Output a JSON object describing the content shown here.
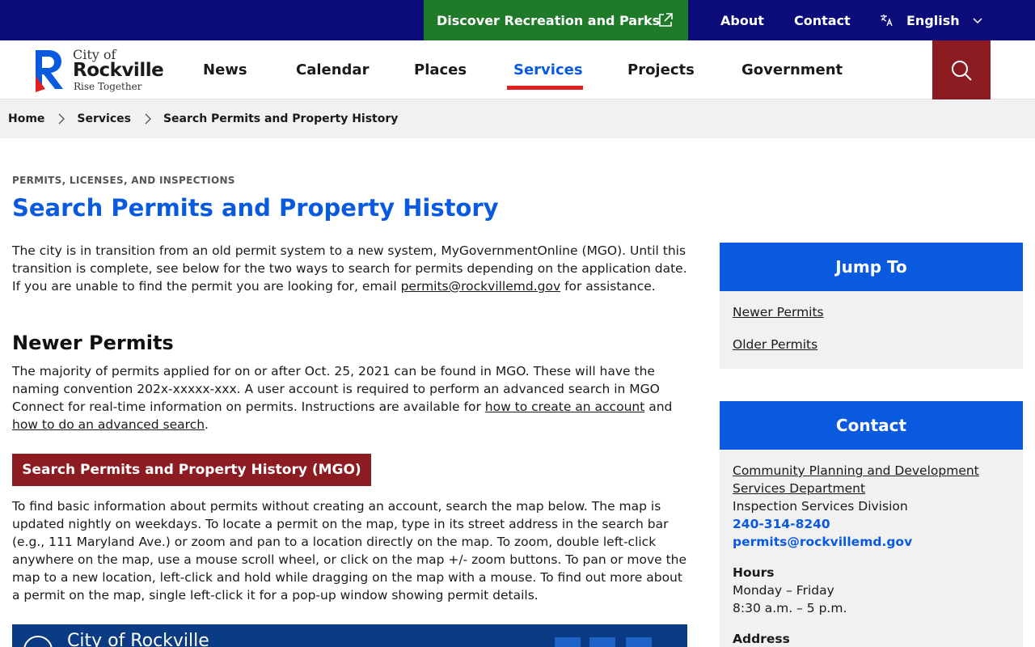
{
  "topbar": {
    "recreation_label": "Discover Recreation and Parks",
    "about": "About",
    "contact": "Contact",
    "language": "English"
  },
  "logo": {
    "city": "City of",
    "name": "Rockville",
    "tagline": "Rise Together"
  },
  "nav": {
    "items": [
      "News",
      "Calendar",
      "Places",
      "Services",
      "Projects",
      "Government"
    ],
    "active": "Services"
  },
  "breadcrumb": [
    "Home",
    "Services",
    "Search Permits and Property History"
  ],
  "main": {
    "eyebrow": "PERMITS, LICENSES, AND INSPECTIONS",
    "title": "Search Permits and Property History",
    "intro_text": "The city is in transition from an old permit system to a new system, MyGovernmentOnline (MGO). Until this transition is complete, see below for the two ways to search for permits depending on the application date. If you are unable to find the permit you are looking for, email ",
    "intro_email": "permits@rockvillemd.gov",
    "intro_tail": " for assistance.",
    "newer_heading": "Newer Permits",
    "newer_text": "The majority of permits applied for on or after Oct. 25, 2021 can be found in MGO. These will have the naming convention 202x-xxxxx-xxx. A user account is required to perform an advanced search in MGO Connect for real-time information on permits. Instructions are available for ",
    "newer_link1": "how to create an account",
    "newer_and": " and ",
    "newer_link2": "how to do an advanced search",
    "newer_period": ".",
    "cta_label": "Search Permits and Property History (MGO)",
    "map_text": "To find basic information about permits without creating an account, search the map below. The map is updated nightly on weekdays. To locate a permit on the map, type in its street address in the search bar (e.g., 111 Maryland Ave.) or zoom and pan to a location directly on the map. To zoom, double left-click anywhere on the map, use a mouse scroll wheel, or click on the map +/- zoom buttons. To pan or move the map to a new location, left-click and hold while dragging on the map with a mouse. To find out more about a permit on the map, single left-click it for a pop-up window showing permit details.",
    "map_title": "City of Rockville"
  },
  "sidebar": {
    "jump_title": "Jump To",
    "jump_links": [
      "Newer Permits",
      "Older Permits"
    ],
    "contact_title": "Contact",
    "dept_line1": "Community Planning and Development",
    "dept_line2": "Services Department",
    "division": "Inspection Services Division",
    "phone": "240-314-8240",
    "email": "permits@rockvillemd.gov",
    "hours_label": "Hours",
    "hours_days": "Monday – Friday",
    "hours_time": "8:30 a.m. – 5 p.m.",
    "address_label": "Address"
  },
  "colors": {
    "topbar": "#0b0b7a",
    "recreation": "#1f7a2a",
    "accent_blue": "#0a5ae0",
    "brand_red": "#8c1b22",
    "nav_underline": "#e02020"
  }
}
